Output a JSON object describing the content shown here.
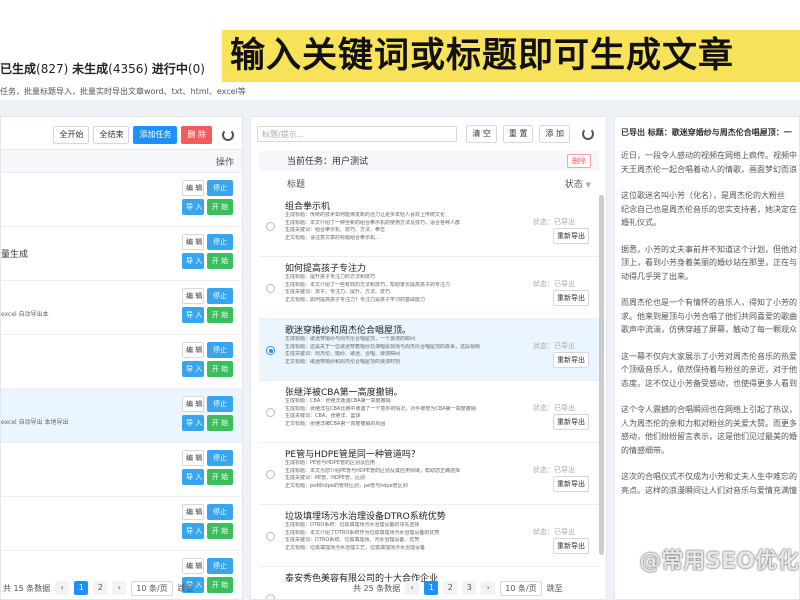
{
  "banner": {
    "title": "输入关键词或标题即可生成文章",
    "stats": {
      "generated_label": "已生成",
      "generated_count": "(827)",
      "not_generated_label": "未生成",
      "not_generated_count": "(4356)",
      "in_progress_label": "进行中",
      "in_progress_count": "(0)"
    },
    "subnote": "任务，批量标题导入，批量实时导出文章word、txt、html、excel等"
  },
  "left_panel": {
    "buttons": {
      "start_all": "全开始",
      "end_all": "全结束",
      "add_task": "添加任务",
      "delete": "删 除"
    },
    "header": "操作",
    "rows": [
      {
        "text": "",
        "selected": false
      },
      {
        "text": "量生成",
        "selected": false
      },
      {
        "text": "excel 自动导出本",
        "selected": false,
        "small": true
      },
      {
        "text": "",
        "selected": false
      },
      {
        "text": "excel 自动导出 本地导出",
        "selected": true,
        "small": true
      },
      {
        "text": "",
        "selected": false
      },
      {
        "text": "",
        "selected": false
      },
      {
        "text": "",
        "selected": false
      }
    ],
    "row_buttons": {
      "edit": "编 辑",
      "stop": "停止",
      "import": "导 入",
      "start": "开 始"
    },
    "pager": {
      "total": "共 15 条数据",
      "pages": [
        "1",
        "2"
      ],
      "per_page": "10 条/页",
      "goto": "跳至"
    }
  },
  "mid_panel": {
    "search_placeholder": "标题/提示...",
    "buttons": {
      "clear": "清 空",
      "reset": "重 置",
      "add": "添 加"
    },
    "current_task": "当前任务：用户测试",
    "delete": "删除",
    "header_title": "标题",
    "header_status": "状态",
    "status_label": "状态：已导出",
    "export_btn": "重新导出",
    "rows": [
      {
        "title": "组合拳示机",
        "selected": false,
        "lines": [
          "生成标题：传统的技术如何能焕发新的活力让更多年轻人喜欢上传统文化",
          "生成标题：本文介绍了一种全新的组合拳示机的使用方法及技巧，适合各种人群",
          "生成关键词：组合拳示机、技巧、方法、拳击",
          "正文标题：请注意文章的标题组合拳示机..."
        ]
      },
      {
        "title": "如何提高孩子专注力",
        "selected": false,
        "lines": [
          "生成标题：提升孩子专注力的方法和技巧",
          "生成标题：本文介绍了一些有效的方法和技巧，帮助家长提高孩子的专注力",
          "生成关键词：孩子、专注力、提升、方法、技巧",
          "正文标题：如何提高孩子专注力？专注力是孩子学习的基础能力"
        ]
      },
      {
        "title": "歌迷穿婚纱和周杰伦合唱屋顶。",
        "selected": true,
        "lines": [
          "生成标题：歌迷穿婚纱与周杰伦合唱屋顶，一个浪漫的瞬间",
          "生成标题：这是关于一位歌迷穿着婚纱在演唱会现场与周杰伦合唱屋顶的故事，这段视频",
          "生成关键词：周杰伦、婚纱、歌迷、合唱、浪漫瞬间",
          "正文标题：歌迷穿婚纱和周杰伦合唱屋顶的浪漫时刻"
        ]
      },
      {
        "title": "张继洋被CBA第一高度撤销。",
        "selected": false,
        "lines": [
          "生成标题：CBA：张继洋遭遇CBA第一高度撤销",
          "生成标题：张继洋在CBA比赛中遭遇了一个意外的情况，对手被誉为CBA第一高度撤销",
          "生成关键词：CBA、张继洋、篮球",
          "正文标题：张继洋被CBA第一高度撤销的原因"
        ]
      },
      {
        "title": "PE管与HDPE管是同一种管道吗？",
        "selected": false,
        "lines": [
          "生成标题：PE管与HDPE管的区别及应用",
          "生成标题：本文为您介绍PE管与HDPE管的区别及其应用领域，帮助您正确选择",
          "生成关键词：PE管、HDPE管、区别",
          "正文标题：pe和hdpe的管材区别，pe管与hdpe管区别"
        ]
      },
      {
        "title": "垃圾填埋场污水治理设备DTRO系统优势",
        "selected": false,
        "lines": [
          "生成标题：DTRO系统：垃圾填埋场污水治理设备的领先选择",
          "生成标题：本文介绍了DTRO系统作为垃圾填埋场污水治理设备的优势",
          "生成关键词：DTRO系统、垃圾填埋场、污水治理设备、优势",
          "正文标题：垃圾填埋场污水治理工艺，垃圾填埋场污水治理设备"
        ]
      },
      {
        "title": "泰安秀色美容有限公司的十大合作企业",
        "selected": false,
        "lines": []
      }
    ],
    "pager": {
      "total": "共 25 条数据",
      "pages": [
        "1",
        "2",
        "3"
      ],
      "per_page": "10 条/页",
      "goto": "跳至"
    }
  },
  "right_panel": {
    "title": "已导出 标题：歌迷穿婚纱与周杰伦合唱屋顶：一",
    "paragraphs": [
      [
        "近日，一段令人感动的视频在网络上疯传。视频中",
        "天王周杰伦一起合唱着动人的情歌，画面梦幻而浪"
      ],
      [
        "这位歌迷名叫小芳（化名），是周杰伦的大粉丝",
        "纪念自己也是周杰伦音乐的忠实支持者，她决定在",
        "婚礼仪式。"
      ],
      [
        "据悉，小芳的丈夫事前并不知道这个计划，但他对",
        "顶上，看到小芳身着美丽的婚纱站在那里，正在与",
        "动得几乎哭了出来。"
      ],
      [
        "而周杰伦也是一个有情怀的音乐人，得知了小芳的",
        "求。他来到屋顶与小芳合唱了他们共同喜爱的歌曲",
        "歌声中流淌，仿佛穿越了屏幕，触动了每一颗观众"
      ],
      [
        "这一幕不仅向大家展示了小芳对周杰伦音乐的热爱",
        "个顶级音乐人，依然保持着与粉丝的亲近，对于他",
        "态度。这不仅让小芳备受感动，也使得更多人看到"
      ],
      [
        "这个令人震撼的合唱瞬间也在网络上引起了热议，",
        "人为周杰伦的亲和力和对粉丝的关爱大赞。而更多",
        "感动，他们纷纷留言表示，这是他们见过最美的婚",
        "的情感细带。"
      ],
      [
        "这次的合唱仪式不仅成为小芳和丈夫人生中难忘的",
        "亮点。这样的浪漫瞬间让人们对音乐与爱情充满憧"
      ]
    ],
    "watermark": "@常用SEO优化"
  },
  "colors": {
    "primary": "#1e90ff",
    "danger": "#f25c5c",
    "success": "#3bbf5d",
    "banner_highlight": "#f7e25a"
  }
}
